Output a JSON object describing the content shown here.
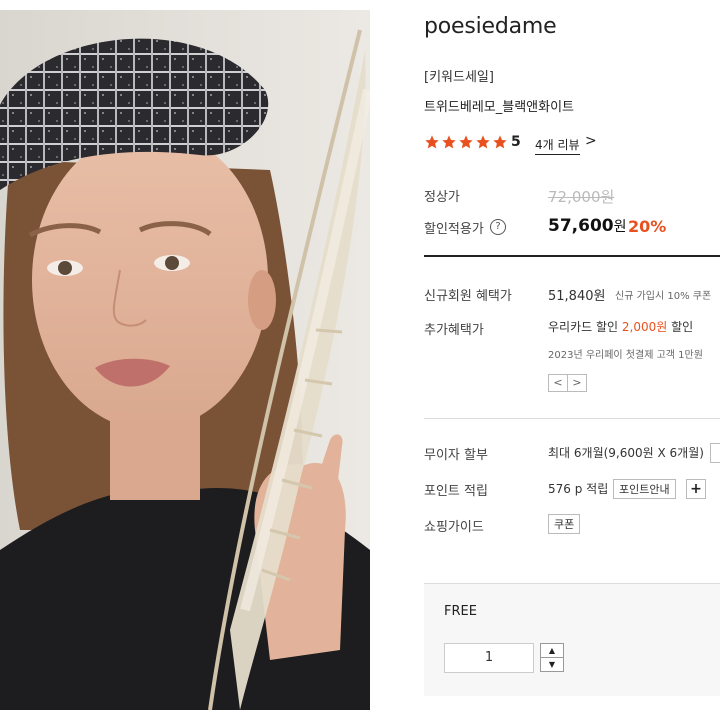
{
  "photo": {
    "alt": "model wearing tweed beret holding pampas grass"
  },
  "product": {
    "brand": "poesiedame",
    "keyword": "[키워드세일]",
    "name": "트위드베레모_블랙앤화이트",
    "rating": "5",
    "review_link": "4개 리뷰",
    "review_chevron": ">",
    "stars_filled": 5
  },
  "price": {
    "regular_label": "정상가",
    "regular_value": "72,000원",
    "sale_label": "할인적용가",
    "help_icon": "?",
    "sale_value": "57,600",
    "sale_unit": "원",
    "sale_rate": "20%"
  },
  "benefits": {
    "new_member_label": "신규회원 혜택가",
    "new_member_value": "51,840원",
    "new_member_note": "신규 가입시 10% 쿠폰",
    "extra_label": "추가혜택가",
    "extra_prefix": "우리카드 할인",
    "extra_amount": "2,000원",
    "extra_suffix": "할인",
    "extra_note": "2023년 우리페이 첫결제 고객 1만원",
    "arrow_prev": "<",
    "arrow_next": ">"
  },
  "info": {
    "installment_label": "무이자 할부",
    "installment_value": "최대 6개월(9,600원 X 6개월)",
    "points_label": "포인트 적립",
    "points_value": "576 p 적립",
    "points_button": "포인트안내",
    "points_plus": "+",
    "guide_label": "쇼핑가이드",
    "guide_button": "쿠폰"
  },
  "option": {
    "label": "FREE",
    "quantity": "1",
    "qty_up": "▲",
    "qty_down": "▼"
  },
  "colors": {
    "accent": "#e8511f",
    "star": "#e8511f"
  }
}
